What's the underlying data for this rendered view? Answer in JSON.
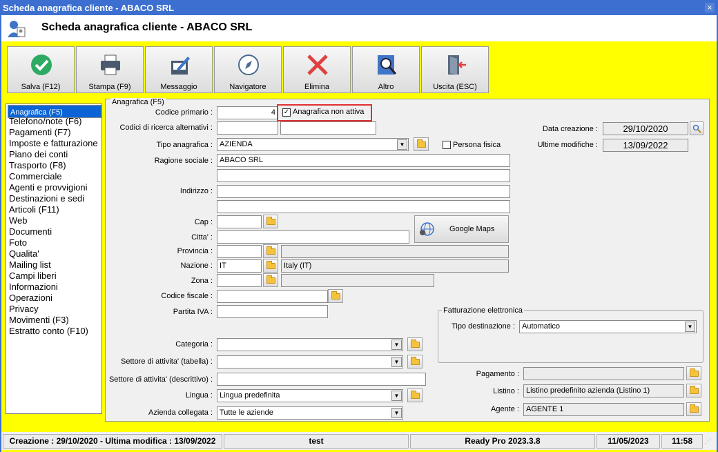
{
  "window": {
    "title": "Scheda anagrafica cliente - ABACO SRL",
    "header": "Scheda anagrafica cliente - ABACO SRL",
    "close": "×"
  },
  "toolbar": [
    {
      "label": "Salva (F12)",
      "icon": "check-icon"
    },
    {
      "label": "Stampa (F9)",
      "icon": "printer-icon"
    },
    {
      "label": "Messaggio",
      "icon": "message-edit-icon"
    },
    {
      "label": "Navigatore",
      "icon": "compass-icon"
    },
    {
      "label": "Elimina",
      "icon": "delete-x-icon"
    },
    {
      "label": "Altro",
      "icon": "search-document-icon"
    },
    {
      "label": "Uscita (ESC)",
      "icon": "exit-door-icon"
    }
  ],
  "nav": {
    "items": [
      "Anagrafica (F5)",
      "Telefono/note (F6)",
      "Pagamenti (F7)",
      "Imposte e fatturazione",
      "Piano dei conti",
      "Trasporto (F8)",
      "Commerciale",
      "Agenti e provvigioni",
      "Destinazioni e sedi",
      "Articoli (F11)",
      "Web",
      "Documenti",
      "Foto",
      "Qualita'",
      "Mailing list",
      "Campi liberi",
      "Informazioni",
      "Operazioni",
      "Privacy",
      "Movimenti (F3)",
      "Estratto conto (F10)"
    ],
    "selected": "Anagrafica (F5)"
  },
  "form": {
    "group_title": "Anagrafica (F5)",
    "codice_primario": {
      "label": "Codice primario :",
      "value": "4"
    },
    "non_attiva": {
      "label": "Anagrafica non attiva",
      "checked": true,
      "mark": "✓"
    },
    "codici_alt": {
      "label": "Codici di ricerca alternativi :",
      "value1": "",
      "value2": ""
    },
    "tipo_anagrafica": {
      "label": "Tipo anagrafica :",
      "value": "AZIENDA"
    },
    "persona_fisica": {
      "label": "Persona fisica",
      "checked": false
    },
    "ragione_sociale": {
      "label": "Ragione sociale :",
      "value": "ABACO SRL",
      "value2": ""
    },
    "indirizzo": {
      "label": "Indirizzo :",
      "value": "",
      "value2": ""
    },
    "cap": {
      "label": "Cap :",
      "value": ""
    },
    "citta": {
      "label": "Citta' :",
      "value": ""
    },
    "google_maps": "Google Maps",
    "provincia": {
      "label": "Provincia :",
      "value": "",
      "desc": ""
    },
    "nazione": {
      "label": "Nazione :",
      "value": "IT",
      "desc": "Italy (IT)"
    },
    "zona": {
      "label": "Zona :",
      "value": "",
      "desc": ""
    },
    "codice_fiscale": {
      "label": "Codice fiscale :",
      "value": ""
    },
    "partita_iva": {
      "label": "Partita IVA :",
      "value": ""
    },
    "categoria": {
      "label": "Categoria :",
      "value": ""
    },
    "settore_tab": {
      "label": "Settore di attivita' (tabella) :",
      "value": ""
    },
    "settore_desc": {
      "label": "Settore di attivita' (descrittivo) :",
      "value": ""
    },
    "lingua": {
      "label": "Lingua :",
      "value": "Lingua predefinita"
    },
    "azienda_collegata": {
      "label": "Azienda collegata :",
      "value": "Tutte le aziende"
    },
    "data_creazione": {
      "label": "Data creazione :",
      "value": "29/10/2020"
    },
    "ultime_modifiche": {
      "label": "Ultime modifiche :",
      "value": "13/09/2022"
    },
    "fe": {
      "title": "Fatturazione elettronica",
      "label": "Tipo destinazione :",
      "value": "Automatico"
    },
    "pagamento": {
      "label": "Pagamento :",
      "value": ""
    },
    "listino": {
      "label": "Listino :",
      "value": "Listino predefinito azienda (Listino 1)"
    },
    "agente": {
      "label": "Agente :",
      "value": "AGENTE 1"
    }
  },
  "status": {
    "creazione": "Creazione : 29/10/2020 - Ultima modifica : 13/09/2022",
    "user": "test",
    "app": "Ready Pro 2023.3.8",
    "date": "11/05/2023",
    "time": "11:58"
  },
  "colors": {
    "accent": "#3c6fd0",
    "background": "#ffff00",
    "selection": "#0a64d6",
    "highlight_border": "#e03030"
  }
}
